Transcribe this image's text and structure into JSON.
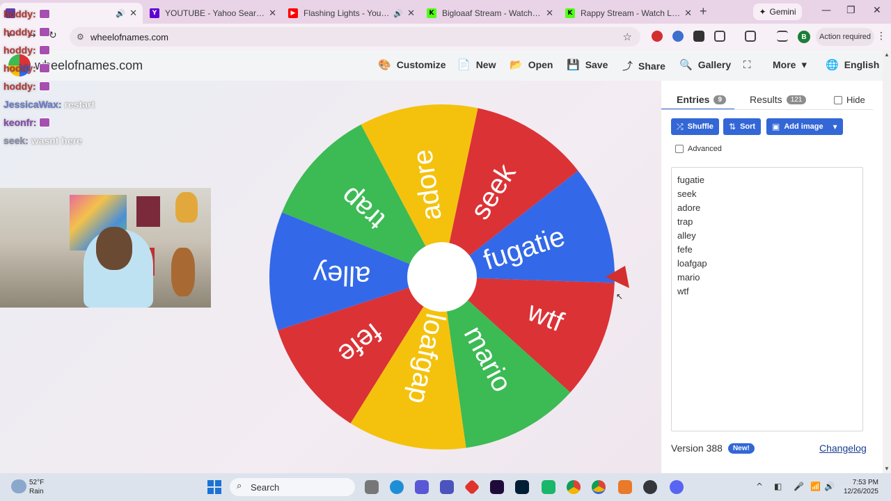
{
  "browser": {
    "tabs": [
      {
        "label": "",
        "favicon_color": "#6441a5",
        "sound": true,
        "active": true
      },
      {
        "label": "YOUTUBE - Yahoo Search Results",
        "favicon_color": "#6001d2",
        "favicon_text": "Y"
      },
      {
        "label": "Flashing Lights - YouTube",
        "favicon_color": "#ff0000",
        "favicon_text": "▶",
        "sound": true
      },
      {
        "label": "Bigloaaf Stream - Watch Live on Kick",
        "favicon_color": "#53fc18",
        "favicon_text": "K"
      },
      {
        "label": "Rappy Stream - Watch Live on Kick",
        "favicon_color": "#53fc18",
        "favicon_text": "K"
      }
    ],
    "gemini_label": "Gemini",
    "url": "wheelofnames.com",
    "profile_initial": "B",
    "action_required": "Action required"
  },
  "site": {
    "name": "wheelofnames.com",
    "nav": [
      {
        "label": "Customize",
        "icon": "palette-icon",
        "glyph": "🎨"
      },
      {
        "label": "New",
        "icon": "file-icon",
        "glyph": "📄"
      },
      {
        "label": "Open",
        "icon": "folder-icon",
        "glyph": "📂"
      },
      {
        "label": "Save",
        "icon": "save-icon",
        "glyph": "💾"
      },
      {
        "label": "Share",
        "icon": "share-icon",
        "glyph": "⤴"
      },
      {
        "label": "Gallery",
        "icon": "search-icon",
        "glyph": "🔍"
      },
      {
        "label": "",
        "icon": "fullscreen-icon",
        "glyph": "⛶"
      },
      {
        "label": "More",
        "icon": "chevron-down-icon",
        "glyph": "▾"
      },
      {
        "label": "English",
        "icon": "globe-icon",
        "glyph": "🌐"
      }
    ]
  },
  "chat": [
    {
      "user": "hoddy:",
      "msg": "",
      "color": "red"
    },
    {
      "user": "hoddy:",
      "msg": "",
      "color": "red"
    },
    {
      "user": "hoddy:",
      "msg": "",
      "color": "red"
    },
    {
      "user": "hoddy:",
      "msg": "",
      "color": "red"
    },
    {
      "user": "hoddy:",
      "msg": "",
      "color": "red"
    },
    {
      "user": "JessicaWax:",
      "msg": "restart",
      "color": "blue"
    },
    {
      "user": "keonfr:",
      "msg": "",
      "color": "purple"
    },
    {
      "user": "seek:",
      "msg": "wasnt here",
      "color": "gray"
    }
  ],
  "wheel": {
    "segments": [
      {
        "label": "seek",
        "color": "#db3236"
      },
      {
        "label": "fugatie",
        "color": "#3369e8"
      },
      {
        "label": "wtf",
        "color": "#db3236"
      },
      {
        "label": "mario",
        "color": "#3cba54"
      },
      {
        "label": "loafgap",
        "color": "#f4c20d"
      },
      {
        "label": "fefe",
        "color": "#db3236"
      },
      {
        "label": "alley",
        "color": "#3369e8"
      },
      {
        "label": "trap",
        "color": "#3cba54"
      },
      {
        "label": "adore",
        "color": "#f4c20d"
      }
    ]
  },
  "panel": {
    "tab_entries": "Entries",
    "entries_count": "9",
    "tab_results": "Results",
    "results_count": "121",
    "hide_label": "Hide",
    "shuffle_label": "Shuffle",
    "sort_label": "Sort",
    "add_image_label": "Add image",
    "advanced_label": "Advanced",
    "entries": [
      "fugatie",
      "seek",
      "adore",
      "trap",
      "alley",
      "fefe",
      "loafgap",
      "mario",
      "wtf"
    ],
    "version": "Version 388",
    "new_badge": "New!",
    "changelog": "Changelog"
  },
  "taskbar": {
    "temp": "52°F",
    "weather": "Rain",
    "search_placeholder": "Search",
    "time": "7:53 PM",
    "date": "12/26/2025"
  }
}
